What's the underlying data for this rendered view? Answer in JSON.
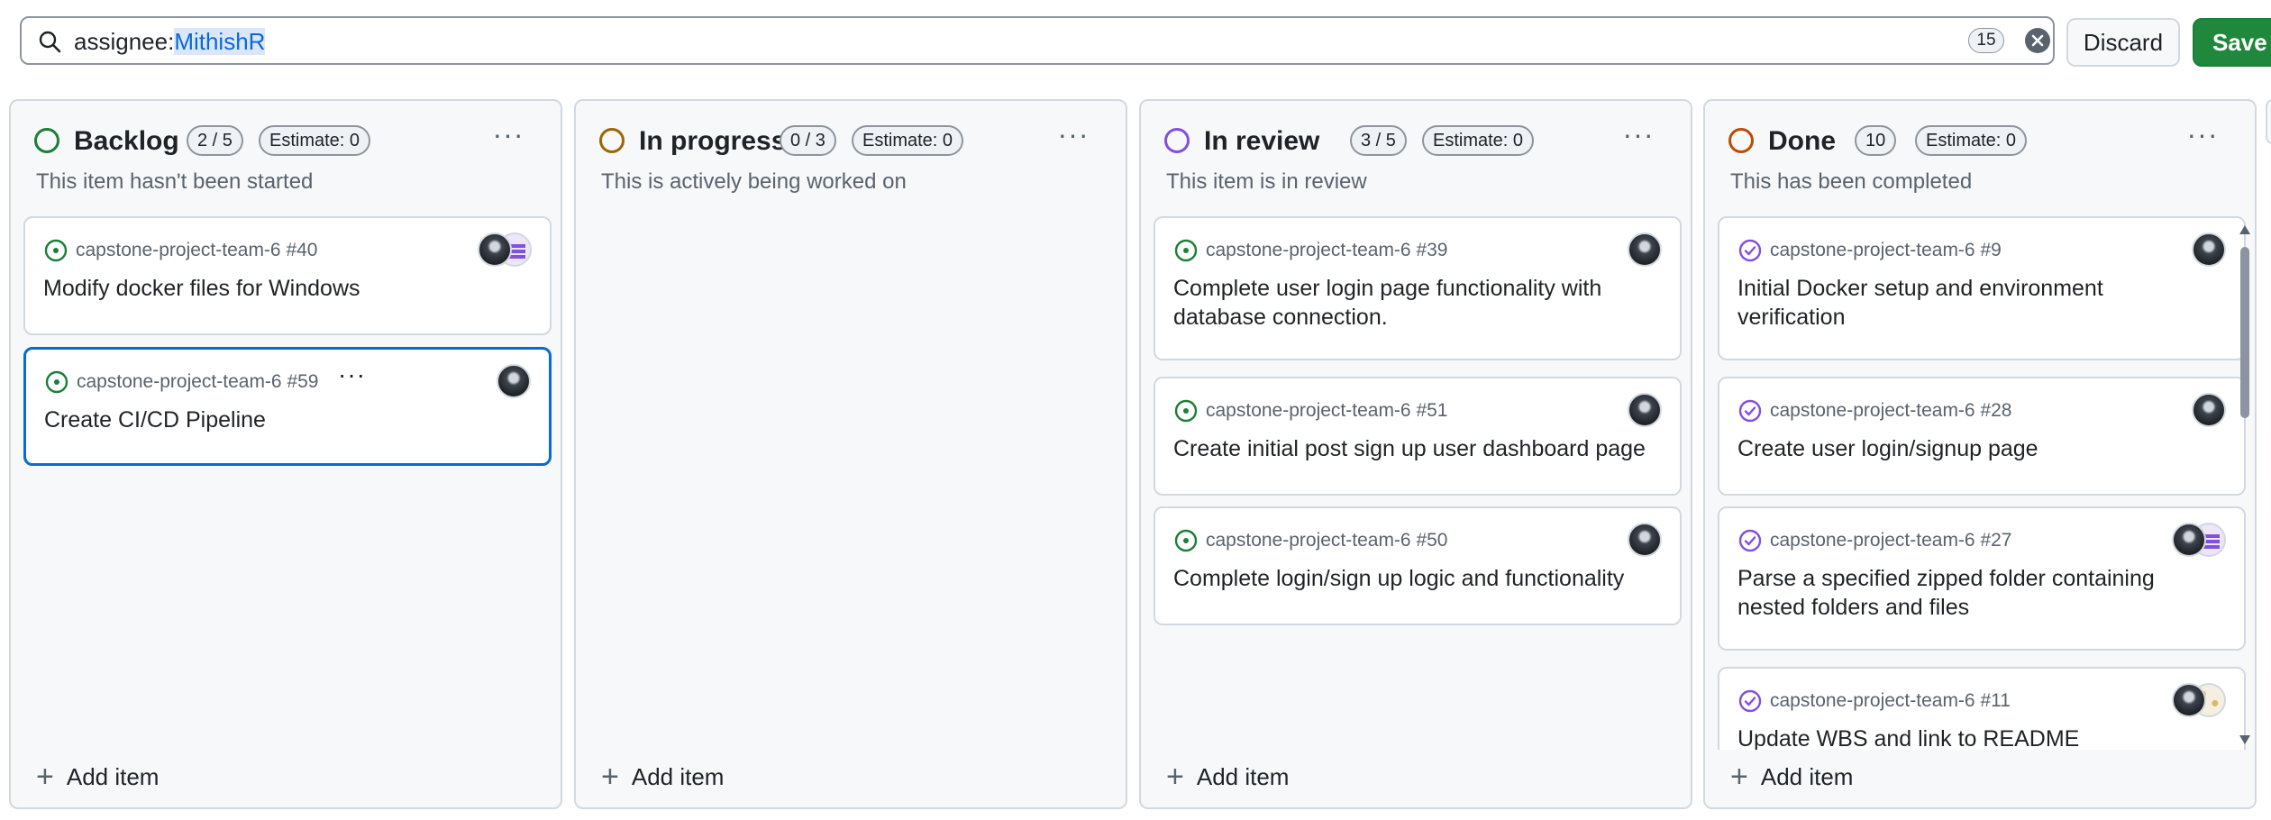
{
  "filter": {
    "prefix": "assignee:",
    "value": "MithishR",
    "count": "15",
    "discard_label": "Discard",
    "save_label": "Save"
  },
  "columns": [
    {
      "title": "Backlog",
      "count": "2 / 5",
      "estimate": "Estimate: 0",
      "description": "This item hasn't been started",
      "status_color": "#1a7f37",
      "add_label": "Add item",
      "cards": [
        {
          "repo": "capstone-project-team-6 #40",
          "title": "Modify docker files for Windows",
          "state": "open"
        },
        {
          "repo": "capstone-project-team-6 #59",
          "title": "Create CI/CD Pipeline",
          "state": "open",
          "menu": "···"
        }
      ]
    },
    {
      "title": "In progress",
      "count": "0 / 3",
      "estimate": "Estimate: 0",
      "description": "This is actively being worked on",
      "status_color": "#9a6700",
      "add_label": "Add item",
      "cards": []
    },
    {
      "title": "In review",
      "count": "3 / 5",
      "estimate": "Estimate: 0",
      "description": "This item is in review",
      "status_color": "#8250df",
      "add_label": "Add item",
      "cards": [
        {
          "repo": "capstone-project-team-6 #39",
          "title": "Complete user login page functionality with database connection.",
          "state": "open"
        },
        {
          "repo": "capstone-project-team-6 #51",
          "title": "Create initial post sign up user dashboard page",
          "state": "open"
        },
        {
          "repo": "capstone-project-team-6 #50",
          "title": "Complete login/sign up logic and functionality",
          "state": "open"
        }
      ]
    },
    {
      "title": "Done",
      "count": "10",
      "estimate": "Estimate: 0",
      "description": "This has been completed",
      "status_color": "#bc4c00",
      "add_label": "Add item",
      "cards": [
        {
          "repo": "capstone-project-team-6 #9",
          "title": "Initial Docker setup and environment verification",
          "state": "closed"
        },
        {
          "repo": "capstone-project-team-6 #28",
          "title": "Create user login/signup page",
          "state": "closed"
        },
        {
          "repo": "capstone-project-team-6 #27",
          "title": "Parse a specified zipped folder containing nested folders and files",
          "state": "closed"
        },
        {
          "repo": "capstone-project-team-6 #11",
          "title": "Update WBS and link to README",
          "state": "closed"
        }
      ]
    }
  ],
  "colors": {
    "open": "#1a7f37",
    "closed": "#8250df",
    "accent": "#0969da",
    "save": "#1f883d"
  }
}
